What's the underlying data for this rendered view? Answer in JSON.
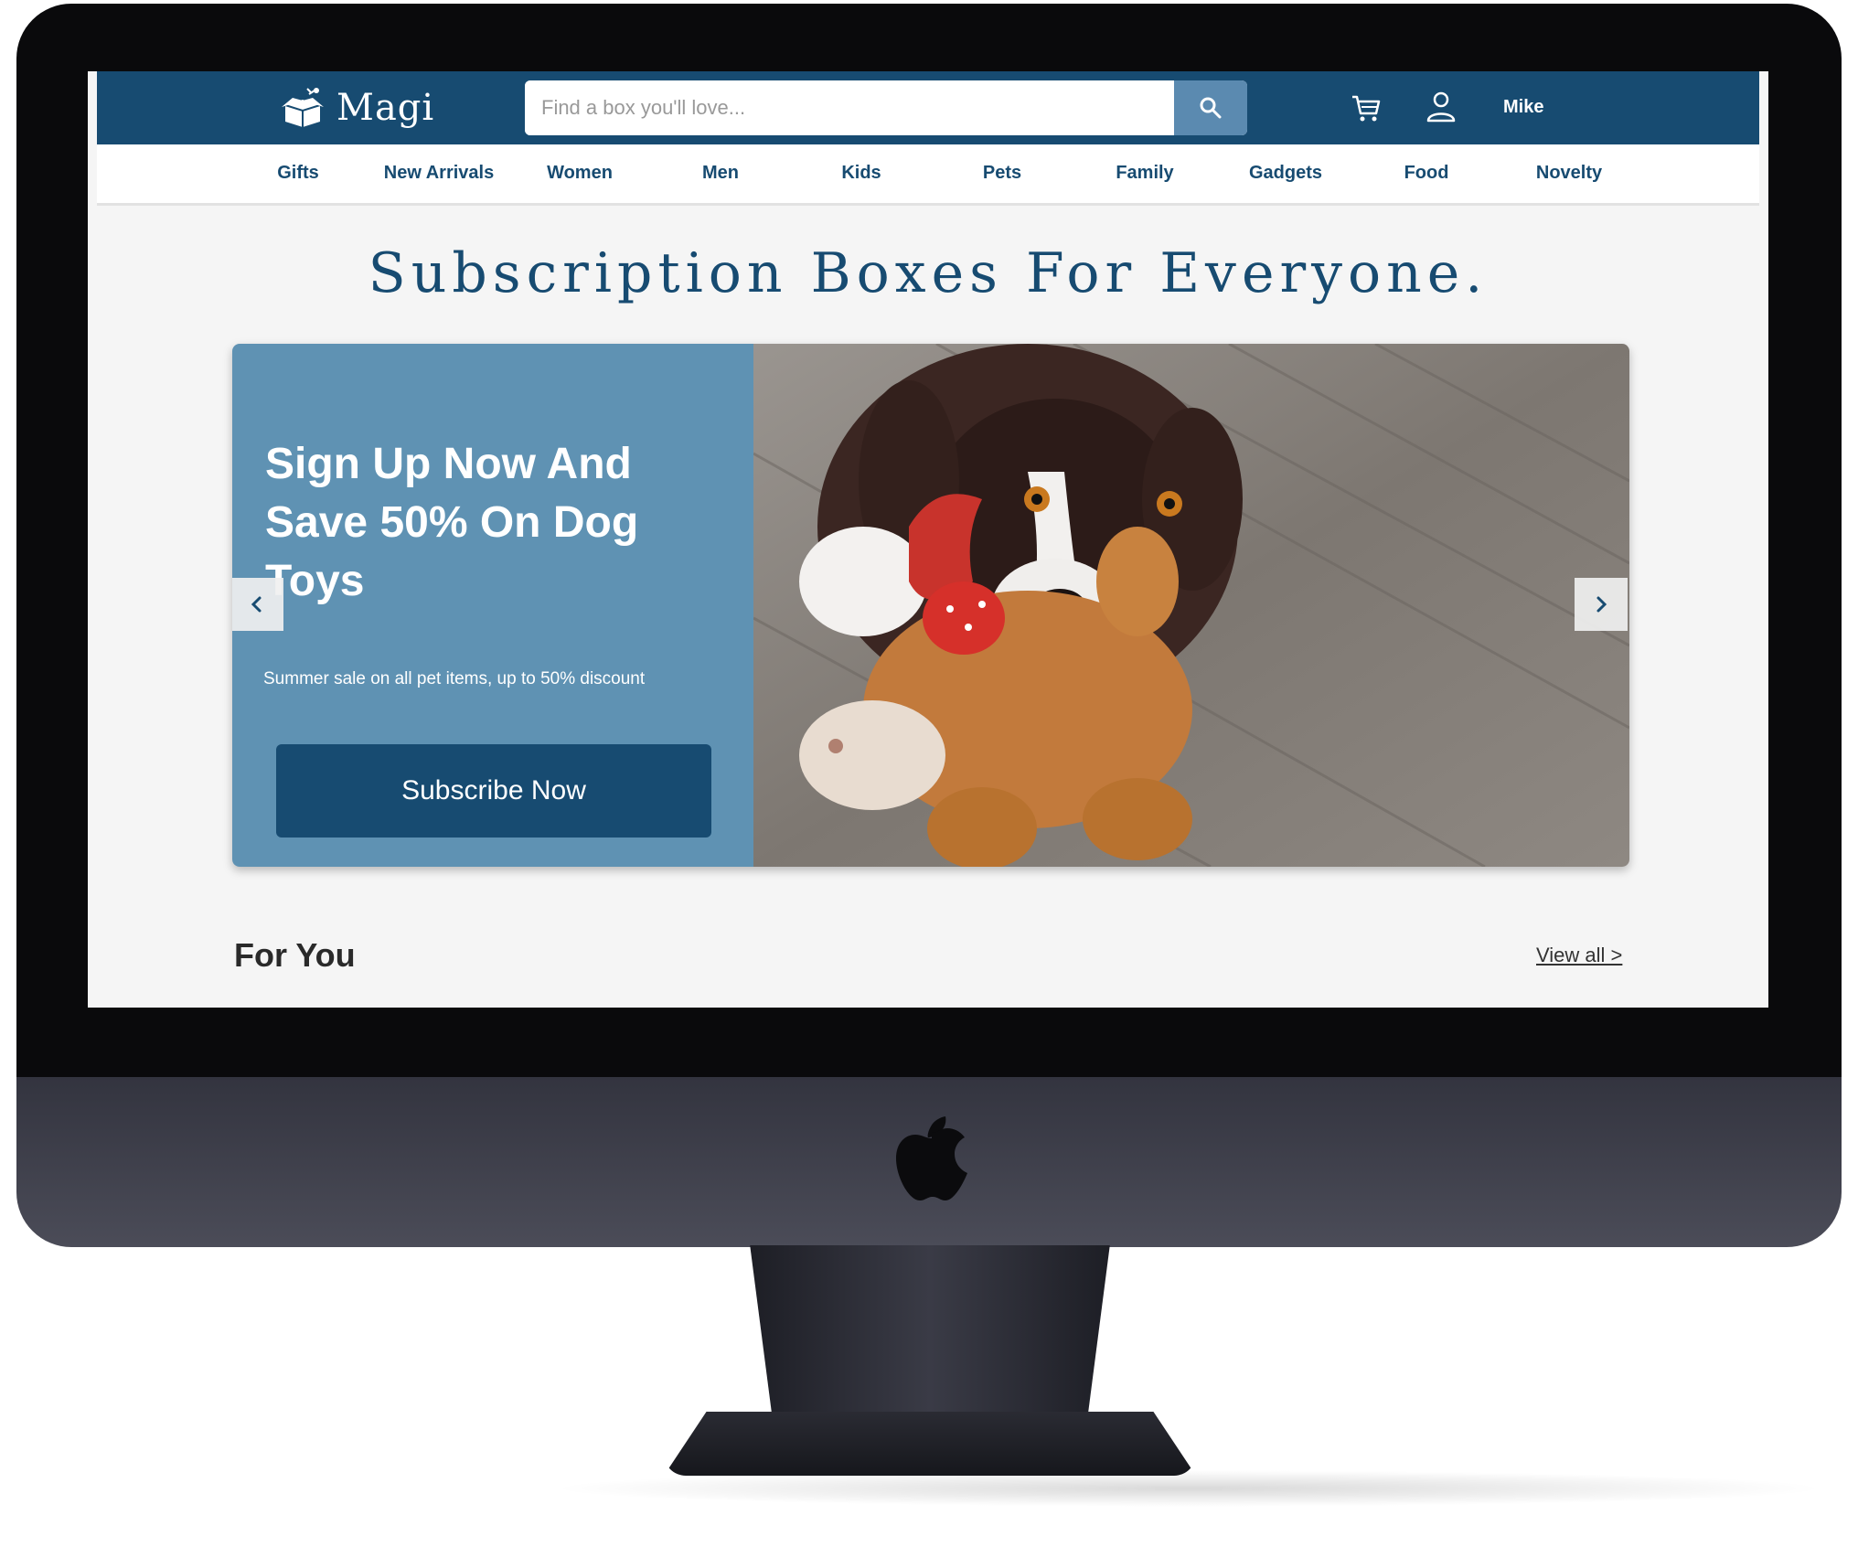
{
  "brand": {
    "name": "Magi"
  },
  "search": {
    "placeholder": "Find a box you'll love...",
    "icon": "search-icon"
  },
  "header": {
    "user_name": "Mike",
    "cart_icon": "cart-icon",
    "user_icon": "user-icon"
  },
  "nav": {
    "items": [
      "Gifts",
      "New Arrivals",
      "Women",
      "Men",
      "Kids",
      "Pets",
      "Family",
      "Gadgets",
      "Food",
      "Novelty"
    ]
  },
  "hero": {
    "headline": "Subscription Boxes For Everyone.",
    "promo_title": "Sign Up Now And Save 50% On Dog Toys",
    "promo_subtitle": "Summer sale on all pet items, up to 50% discount",
    "cta_label": "Subscribe Now",
    "prev_icon": "chevron-left-icon",
    "next_icon": "chevron-right-icon"
  },
  "section": {
    "title": "For You",
    "view_all": "View all >"
  },
  "colors": {
    "primary": "#174b71",
    "accent": "#5b8ab0",
    "promo_bg": "#5f92b3",
    "page_bg": "#f5f5f5"
  }
}
